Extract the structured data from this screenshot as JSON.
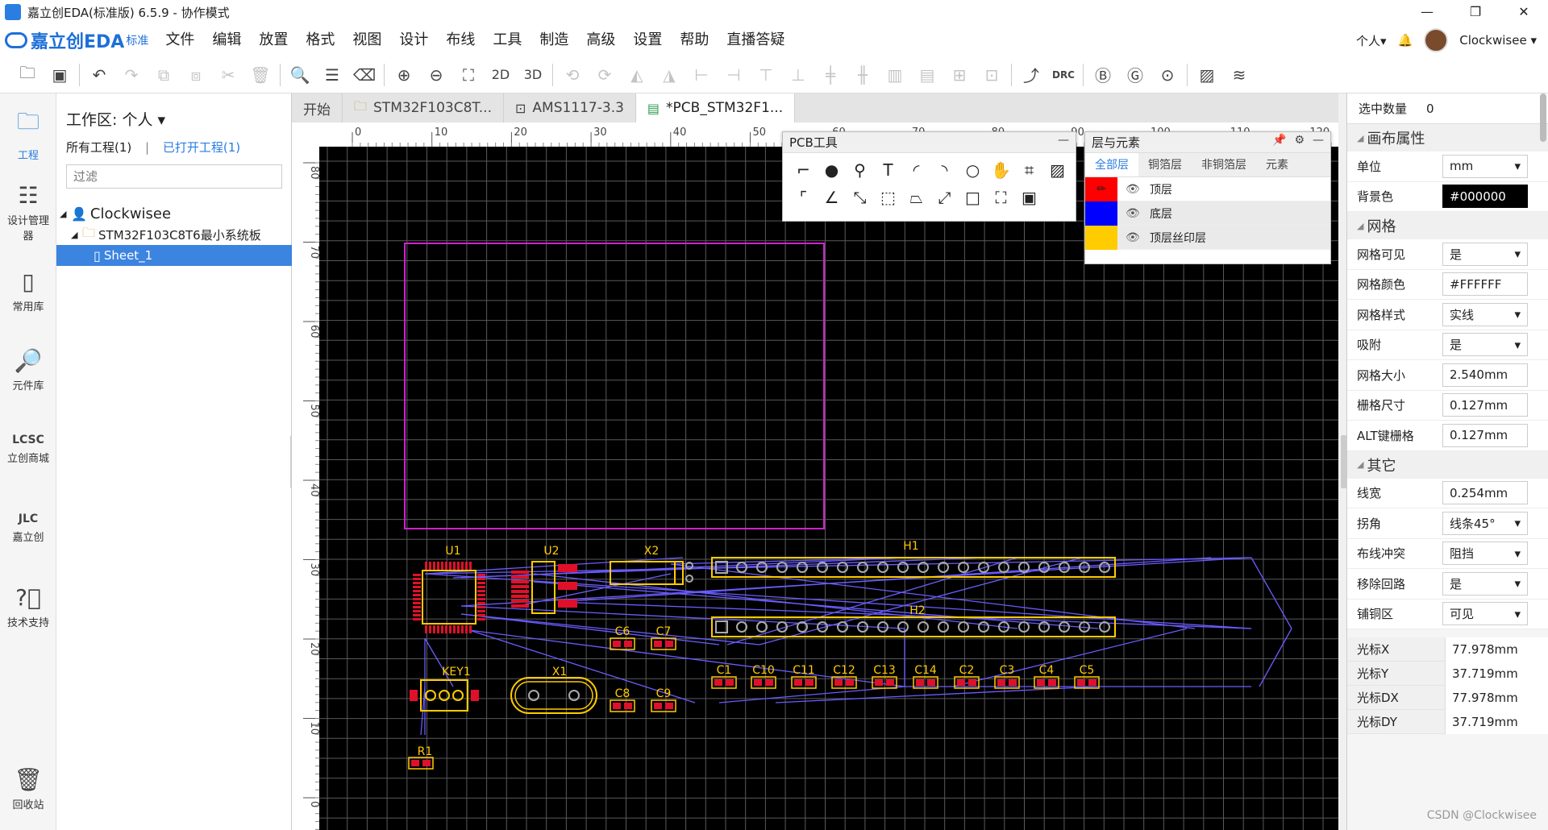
{
  "window": {
    "title": "嘉立创EDA(标准版) 6.5.9 - 协作模式",
    "min": "—",
    "max": "❐",
    "close": "✕"
  },
  "logo": {
    "text": "嘉立创EDA",
    "edition": "标准"
  },
  "menu": [
    "文件",
    "编辑",
    "放置",
    "格式",
    "视图",
    "设计",
    "布线",
    "工具",
    "制造",
    "高级",
    "设置",
    "帮助",
    "直播答疑"
  ],
  "user": {
    "personal": "个人▾",
    "name": "Clockwisee ▾"
  },
  "toolbar": {
    "btn_2d": "2D",
    "btn_3d": "3D",
    "btn_drc": "DRC"
  },
  "leftnav": [
    {
      "label": "工程"
    },
    {
      "label": "设计管理器"
    },
    {
      "label": "常用库"
    },
    {
      "label": "元件库"
    },
    {
      "label": "立创商城"
    },
    {
      "label": "嘉立创"
    },
    {
      "label": "技术支持"
    },
    {
      "label": "回收站"
    }
  ],
  "project": {
    "workspace": "工作区: 个人 ▾",
    "all": "所有工程(1)",
    "sep": "|",
    "opened": "已打开工程(1)",
    "filter_placeholder": "过滤",
    "tree": {
      "user": "Clockwisee",
      "proj": "STM32F103C8T6最小系统板",
      "sheet": "Sheet_1"
    }
  },
  "tabs": [
    {
      "label": "开始"
    },
    {
      "label": "STM32F103C8T..."
    },
    {
      "label": "AMS1117-3.3"
    },
    {
      "label": "*PCB_STM32F1..."
    }
  ],
  "ruler": {
    "h": [
      "0",
      "10",
      "20",
      "30",
      "40",
      "50",
      "60",
      "70",
      "80",
      "90",
      "100",
      "110",
      "120"
    ],
    "v": [
      "80",
      "70",
      "60",
      "50",
      "40",
      "30",
      "20",
      "10",
      "0"
    ]
  },
  "pcbtools": {
    "title": "PCB工具",
    "close": "—"
  },
  "layers": {
    "title": "层与元素",
    "tabs": [
      "全部层",
      "铜箔层",
      "非铜箔层",
      "元素"
    ],
    "rows": [
      {
        "name": "顶层",
        "color": "#ff0000"
      },
      {
        "name": "底层",
        "color": "#0000ff"
      },
      {
        "name": "顶层丝印层",
        "color": "#ffcc00"
      }
    ]
  },
  "components": [
    "U1",
    "U2",
    "X2",
    "H1",
    "H2",
    "C6",
    "C7",
    "KEY1",
    "X1",
    "C8",
    "C9",
    "C1",
    "C10",
    "C11",
    "C12",
    "C13",
    "C14",
    "C2",
    "C3",
    "C4",
    "C5",
    "R1"
  ],
  "right": {
    "sel_label": "选中数量",
    "sel_value": "0",
    "canvas_section": "画布属性",
    "unit": {
      "k": "单位",
      "v": "mm"
    },
    "bg": {
      "k": "背景色",
      "v": "#000000"
    },
    "grid_section": "网格",
    "grid_visible": {
      "k": "网格可见",
      "v": "是"
    },
    "grid_color": {
      "k": "网格颜色",
      "v": "#FFFFFF"
    },
    "grid_style": {
      "k": "网格样式",
      "v": "实线"
    },
    "snap": {
      "k": "吸附",
      "v": "是"
    },
    "grid_size": {
      "k": "网格大小",
      "v": "2.540mm"
    },
    "fence": {
      "k": "栅格尺寸",
      "v": "0.127mm"
    },
    "alt": {
      "k": "ALT键栅格",
      "v": "0.127mm"
    },
    "other_section": "其它",
    "width": {
      "k": "线宽",
      "v": "0.254mm"
    },
    "corner": {
      "k": "拐角",
      "v": "线条45°"
    },
    "conflict": {
      "k": "布线冲突",
      "v": "阻挡"
    },
    "loop": {
      "k": "移除回路",
      "v": "是"
    },
    "pour": {
      "k": "铺铜区",
      "v": "可见"
    },
    "cx": {
      "k": "光标X",
      "v": "77.978mm"
    },
    "cy": {
      "k": "光标Y",
      "v": "37.719mm"
    },
    "cdx": {
      "k": "光标DX",
      "v": "77.978mm"
    },
    "cdy": {
      "k": "光标DY",
      "v": "37.719mm"
    }
  },
  "watermark": "CSDN @Clockwisee"
}
